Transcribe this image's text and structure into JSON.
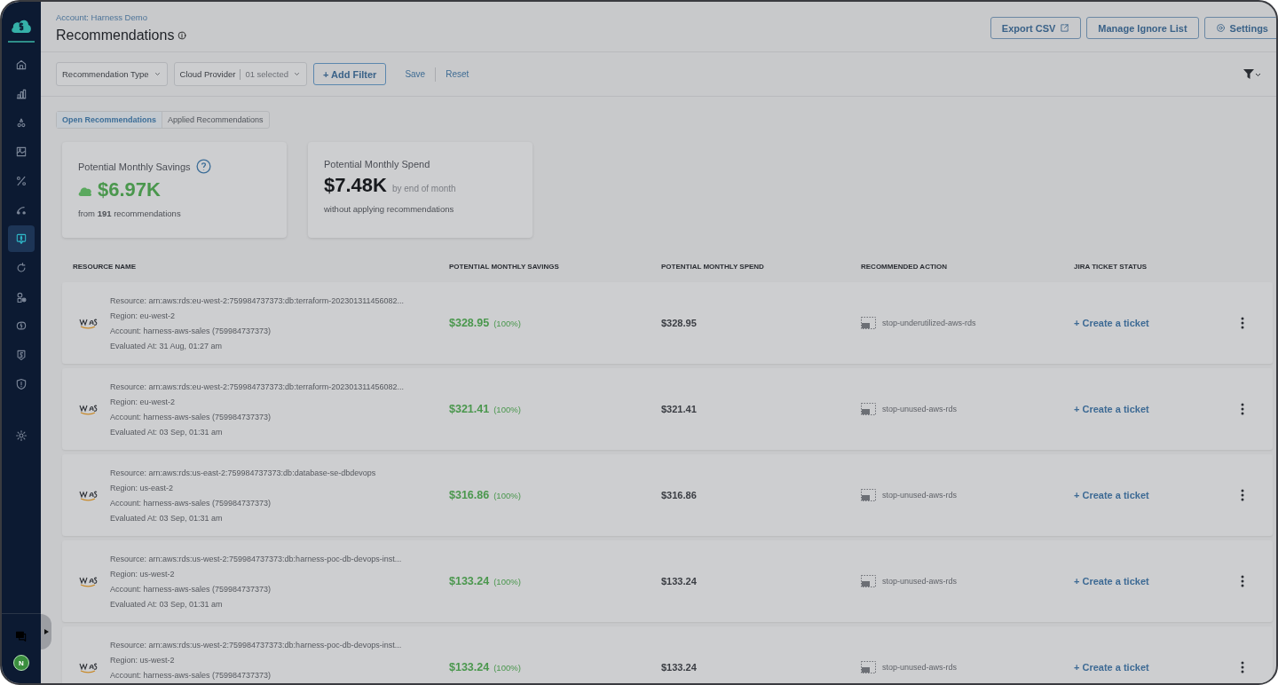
{
  "sidebar": {
    "items": [
      {
        "kind": "home",
        "selected": false
      },
      {
        "kind": "chart",
        "selected": false
      },
      {
        "kind": "hierarchy",
        "selected": false
      },
      {
        "kind": "frame",
        "selected": false
      },
      {
        "kind": "percent",
        "selected": false
      },
      {
        "kind": "route",
        "selected": false
      },
      {
        "kind": "recommend",
        "selected": true
      },
      {
        "kind": "refresh",
        "selected": false
      },
      {
        "kind": "shapes",
        "selected": false
      },
      {
        "kind": "piggy",
        "selected": false
      },
      {
        "kind": "dollar",
        "selected": false
      },
      {
        "kind": "shield",
        "selected": false
      },
      {
        "kind": "gear",
        "selected": false
      }
    ],
    "avatar": "N"
  },
  "header": {
    "account": "Account: Harness Demo",
    "title": "Recommendations",
    "buttons": [
      {
        "kind": "export",
        "label": "Export CSV"
      },
      {
        "kind": "plain",
        "label": "Manage Ignore List"
      },
      {
        "kind": "settings",
        "label": "Settings"
      }
    ]
  },
  "filters": {
    "recommendation_type": "Recommendation Type",
    "cloud_provider": {
      "label": "Cloud Provider",
      "value": "01 selected"
    },
    "add_filter": "+ Add Filter",
    "save": "Save",
    "reset": "Reset"
  },
  "tabs": [
    {
      "label": "Open Recommendations",
      "selected": true
    },
    {
      "label": "Applied Recommendations",
      "selected": false
    }
  ],
  "summary": [
    {
      "kind": "savings",
      "title": "Potential Monthly Savings",
      "value": "$6.97K",
      "note": "from **191** recommendations"
    },
    {
      "kind": "spend",
      "title": "Potential Monthly Spend",
      "value": "$7.48K",
      "suffix": "by end of month",
      "note": "without applying recommendations"
    }
  ],
  "table": {
    "columns": [
      "RESOURCE NAME",
      "POTENTIAL MONTHLY SAVINGS",
      "POTENTIAL MONTHLY SPEND",
      "RECOMMENDED ACTION",
      "JIRA TICKET STATUS"
    ],
    "rows": [
      {
        "resource": "Resource: arn:aws:rds:eu-west-2:759984737373:db:terraform-202301311456082...",
        "region": "Region: eu-west-2",
        "account": "Account: harness-aws-sales (759984737373)",
        "evaluated": "Evaluated At: 31 Aug, 01:27 am",
        "savings": "$328.95",
        "percent": "(100%)",
        "spend": "$328.95",
        "action": "stop-underutilized-aws-rds",
        "ticket": "+ Create a ticket"
      },
      {
        "resource": "Resource: arn:aws:rds:eu-west-2:759984737373:db:terraform-202301311456082...",
        "region": "Region: eu-west-2",
        "account": "Account: harness-aws-sales (759984737373)",
        "evaluated": "Evaluated At: 03 Sep, 01:31 am",
        "savings": "$321.41",
        "percent": "(100%)",
        "spend": "$321.41",
        "action": "stop-unused-aws-rds",
        "ticket": "+ Create a ticket"
      },
      {
        "resource": "Resource: arn:aws:rds:us-east-2:759984737373:db:database-se-dbdevops",
        "region": "Region: us-east-2",
        "account": "Account: harness-aws-sales (759984737373)",
        "evaluated": "Evaluated At: 03 Sep, 01:31 am",
        "savings": "$316.86",
        "percent": "(100%)",
        "spend": "$316.86",
        "action": "stop-unused-aws-rds",
        "ticket": "+ Create a ticket"
      },
      {
        "resource": "Resource: arn:aws:rds:us-west-2:759984737373:db:harness-poc-db-devops-inst...",
        "region": "Region: us-west-2",
        "account": "Account: harness-aws-sales (759984737373)",
        "evaluated": "Evaluated At: 03 Sep, 01:31 am",
        "savings": "$133.24",
        "percent": "(100%)",
        "spend": "$133.24",
        "action": "stop-unused-aws-rds",
        "ticket": "+ Create a ticket"
      },
      {
        "resource": "Resource: arn:aws:rds:us-west-2:759984737373:db:harness-poc-db-devops-inst...",
        "region": "Region: us-west-2",
        "account": "Account: harness-aws-sales (759984737373)",
        "savings": "$133.24",
        "percent": "(100%)",
        "spend": "$133.24",
        "action": "stop-unused-aws-rds",
        "ticket": "+ Create a ticket"
      }
    ]
  }
}
